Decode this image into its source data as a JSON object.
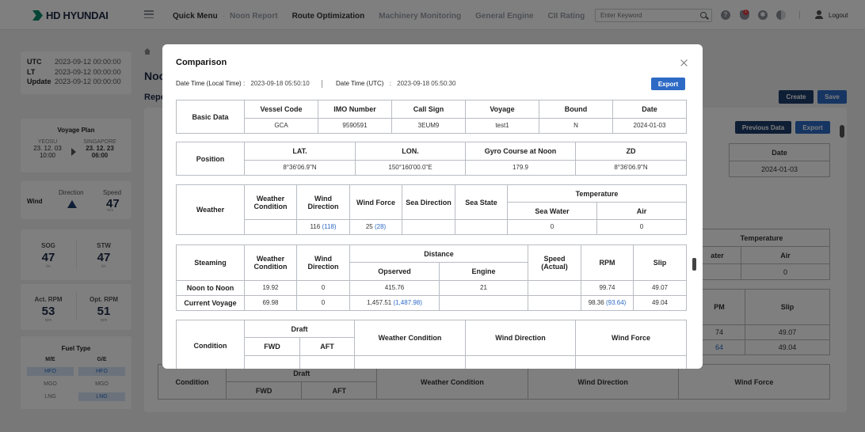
{
  "app": {
    "brand": "HD HYUNDAI"
  },
  "nav": {
    "items": [
      "Quick Menu",
      "Noon Report",
      "Route Optimization",
      "Machinery Monitoring",
      "General Engine",
      "CII Rating"
    ],
    "separator": "·",
    "more": "≫",
    "search_placeholder": "Enter Keyword",
    "notification_count": "1",
    "logout": "Logout"
  },
  "times": [
    {
      "key": "UTC",
      "value": "2023-09-12 00:00:00"
    },
    {
      "key": "LT",
      "value": "2023-09-12 00:00:00"
    },
    {
      "key": "Update",
      "value": "2023-09-12 00:00:00"
    }
  ],
  "voyage_plan": {
    "title": "Voyage Plan",
    "from": {
      "port": "YEOSU",
      "date": "23. 12. 03",
      "time": "10:00"
    },
    "to": {
      "port": "SINGAPORE",
      "date": "23. 12. 23",
      "time": "06:00"
    }
  },
  "wind": {
    "label": "Wind",
    "direction_label": "Direction",
    "speed_label": "Speed",
    "speed": "47",
    "unit": "m/s"
  },
  "sog": {
    "label": "SOG",
    "value": "47",
    "unit": "kn"
  },
  "stw": {
    "label": "STW",
    "value": "47",
    "unit": "kn"
  },
  "act_rpm": {
    "label": "Act. RPM",
    "value": "53",
    "unit": "rpm"
  },
  "opt_rpm": {
    "label": "Opt. RPM",
    "value": "51",
    "unit": "rpm"
  },
  "fuel": {
    "title": "Fuel Type",
    "cols": [
      "M/E",
      "G/E"
    ],
    "rows": [
      {
        "me": "HFO",
        "ge": "HFO"
      },
      {
        "me": "MGO",
        "ge": "MGO"
      },
      {
        "me": "LNG",
        "ge": "LNG"
      }
    ]
  },
  "page": {
    "title_partial": "Noo",
    "report_partial": "Repo",
    "buttons": {
      "create": "Create",
      "save": "Save",
      "previous_data": "Previous Data",
      "export": "Export"
    },
    "bg": {
      "date": "Date",
      "date_value": "2024-01-03",
      "temperature": "Temperature",
      "water_partial": "ater",
      "air": "Air",
      "zero": "0",
      "pm_partial": "PM",
      "slip": "Slip",
      "slip1": "49.07",
      "slip2": "49.04",
      "v74": "74",
      "v64": "64",
      "draft": "Draft",
      "condition": "Condition",
      "fwd": "FWD",
      "aft": "AFT",
      "weather_condition": "Weather Condition",
      "wind_direction": "Wind Direction",
      "wind_force": "Wind Force"
    }
  },
  "modal": {
    "title": "Comparison",
    "local_label": "Date Time (Local Time)",
    "local_value": "2023-09-18 05:50:10",
    "utc_label": "Date Time (UTC)",
    "utc_value": "2023-09-18  05:50:30",
    "colon": ":",
    "export": "Export",
    "basic": {
      "section": "Basic Data",
      "headers": [
        "Vessel Code",
        "IMO Number",
        "Call Sign",
        "Voyage",
        "Bound",
        "Date"
      ],
      "values": [
        "GCA",
        "9590591",
        "3EUM9",
        "test1",
        "N",
        "2024-01-03"
      ]
    },
    "position": {
      "section": "Position",
      "headers": [
        "LAT.",
        "LON.",
        "Gyro Course at Noon",
        "ZD"
      ],
      "values": [
        "8°36'06.9\"N",
        "150°160'00.0\"E",
        "179.9",
        "8°36'06.9\"N"
      ]
    },
    "weather": {
      "section": "Weather",
      "weather_condition": "Weather Condition",
      "wind_direction": "Wind Direction",
      "wind_force": "Wind Force",
      "sea_direction": "Sea Direction",
      "sea_state": "Sea State",
      "temperature": "Temperature",
      "sea_water": "Sea Water",
      "air": "Air",
      "wind_dir_val": "116",
      "wind_dir_prev": "(118)",
      "wind_force_val": "25",
      "wind_force_prev": "(28)",
      "sea_water_val": "0",
      "air_val": "0"
    },
    "steaming": {
      "section": "Steaming",
      "weather_condition": "Weather Condition",
      "wind_direction": "Wind Direction",
      "distance": "Distance",
      "observed": "Opserved",
      "engine": "Engine",
      "speed": "Speed (Actual)",
      "rpm": "RPM",
      "slip": "Slip",
      "rows": [
        {
          "label": "Noon to Noon",
          "wc": "19.92",
          "wd": "0",
          "obs": "415.76",
          "obs_prev": "",
          "eng": "21",
          "spd": "",
          "rpm": "99.74",
          "rpm_prev": "",
          "slip": "49.07"
        },
        {
          "label": "Current Voyage",
          "wc": "69.98",
          "wd": "0",
          "obs": "1,457.51",
          "obs_prev": "(1,487.98)",
          "eng": "",
          "spd": "",
          "rpm": "98.36",
          "rpm_prev": "(93.64)",
          "slip": "49.04"
        }
      ]
    },
    "condition": {
      "section": "Condition",
      "draft": "Draft",
      "fwd": "FWD",
      "aft": "AFT",
      "weather_condition": "Weather Condition",
      "wind_direction": "Wind Direction",
      "wind_force": "Wind Force"
    }
  }
}
